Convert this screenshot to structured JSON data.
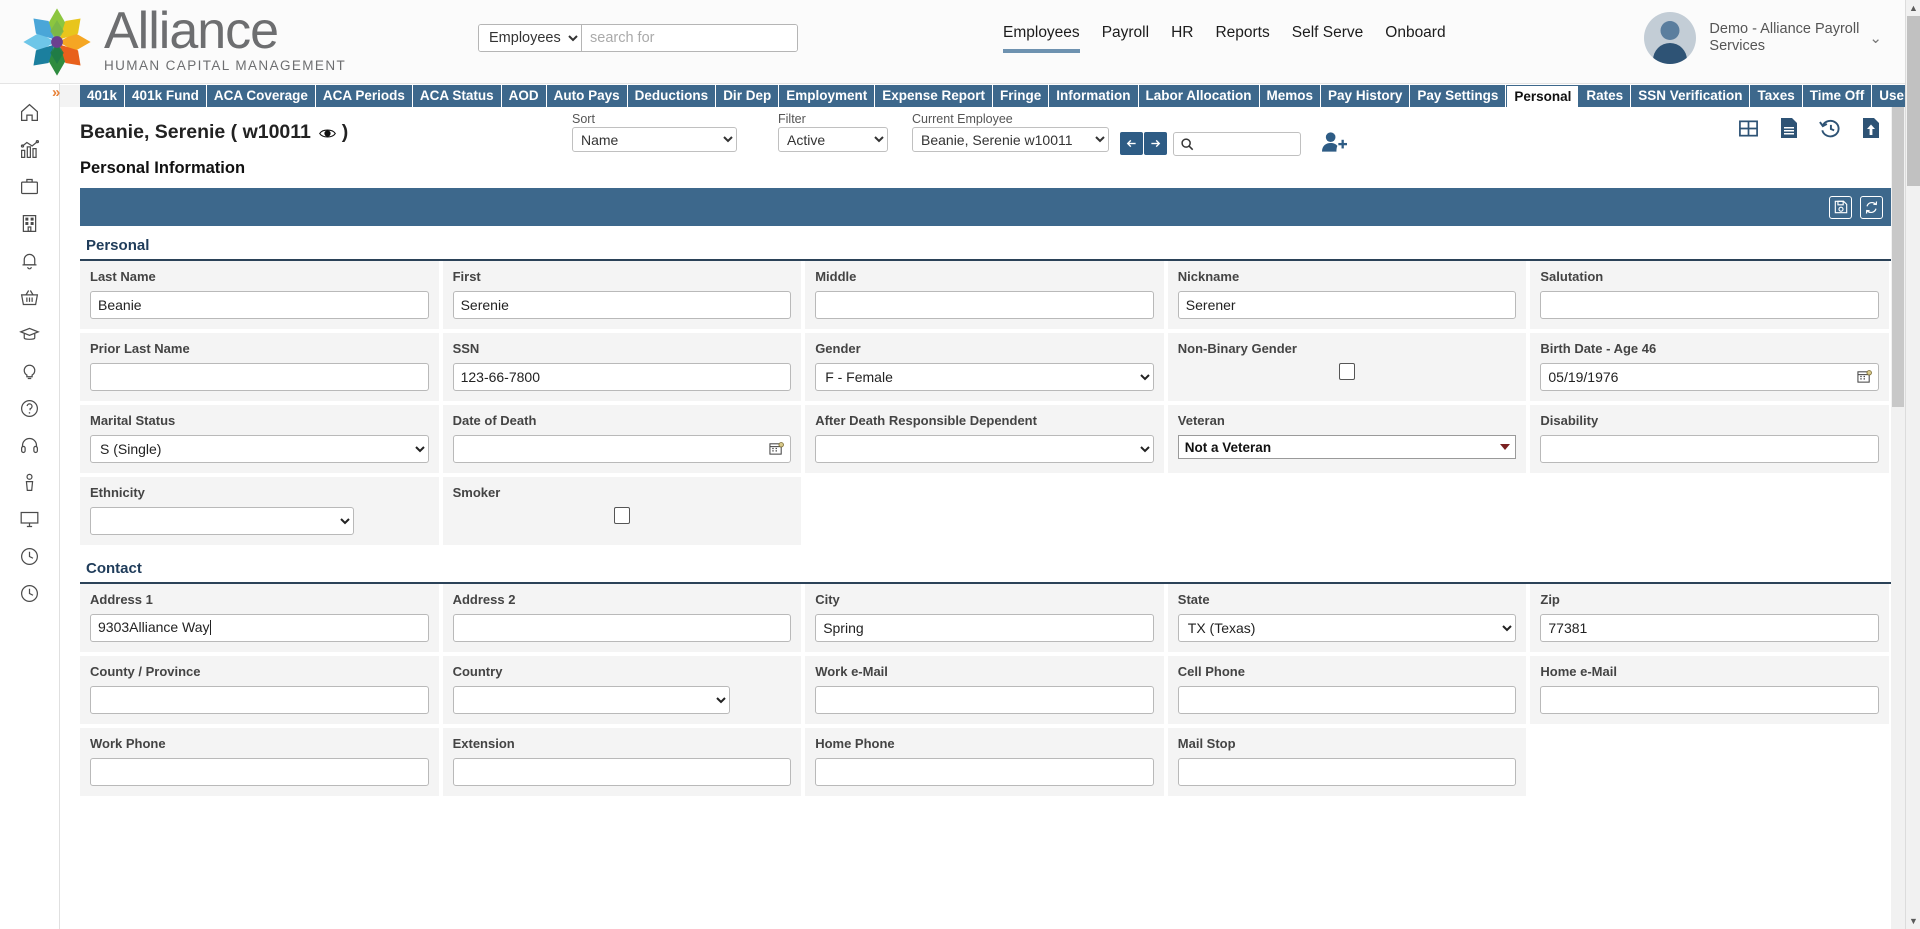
{
  "brand": {
    "name": "Alliance",
    "subtitle": "HUMAN CAPITAL MANAGEMENT"
  },
  "search": {
    "scope": "Employees",
    "placeholder": "search for",
    "value": ""
  },
  "mainnav": [
    {
      "label": "Employees",
      "active": true
    },
    {
      "label": "Payroll",
      "active": false
    },
    {
      "label": "HR",
      "active": false
    },
    {
      "label": "Reports",
      "active": false
    },
    {
      "label": "Self Serve",
      "active": false
    },
    {
      "label": "Onboard",
      "active": false
    }
  ],
  "profile": {
    "name": "Demo - Alliance Payroll Services",
    "caret": "⌄"
  },
  "sidebar": {
    "items": [
      {
        "icon": "home-icon"
      },
      {
        "icon": "analytics-icon"
      },
      {
        "icon": "briefcase-icon"
      },
      {
        "icon": "building-icon"
      },
      {
        "icon": "bell-icon"
      },
      {
        "icon": "basket-icon"
      },
      {
        "icon": "graduation-cap-icon"
      },
      {
        "icon": "lightbulb-icon"
      },
      {
        "icon": "question-circle-icon"
      },
      {
        "icon": "headphones-icon"
      },
      {
        "icon": "person-icon"
      },
      {
        "icon": "monitor-icon"
      },
      {
        "icon": "clock-icon"
      },
      {
        "icon": "clock-history-icon"
      }
    ]
  },
  "tabs": [
    {
      "label": "401k",
      "active": false
    },
    {
      "label": "401k Fund",
      "active": false
    },
    {
      "label": "ACA Coverage",
      "active": false
    },
    {
      "label": "ACA Periods",
      "active": false
    },
    {
      "label": "ACA Status",
      "active": false
    },
    {
      "label": "AOD",
      "active": false
    },
    {
      "label": "Auto Pays",
      "active": false
    },
    {
      "label": "Deductions",
      "active": false
    },
    {
      "label": "Dir Dep",
      "active": false
    },
    {
      "label": "Employment",
      "active": false
    },
    {
      "label": "Expense Report",
      "active": false
    },
    {
      "label": "Fringe",
      "active": false
    },
    {
      "label": "Information",
      "active": false
    },
    {
      "label": "Labor Allocation",
      "active": false
    },
    {
      "label": "Memos",
      "active": false
    },
    {
      "label": "Pay History",
      "active": false
    },
    {
      "label": "Pay Settings",
      "active": false
    },
    {
      "label": "Personal",
      "active": true
    },
    {
      "label": "Rates",
      "active": false
    },
    {
      "label": "SSN Verification",
      "active": false
    },
    {
      "label": "Taxes",
      "active": false
    },
    {
      "label": "Time Off",
      "active": false
    },
    {
      "label": "User Defined",
      "active": false
    }
  ],
  "employee_header": {
    "name": "Beanie, Serenie ( w10011",
    "name_suffix": ")",
    "sort_label": "Sort",
    "sort_value": "Name",
    "filter_label": "Filter",
    "filter_value": "Active",
    "current_label": "Current Employee",
    "current_value": "Beanie, Serenie w10011",
    "prev_icon": "arrow-left-icon",
    "next_icon": "arrow-right-icon",
    "search_icon": "search-icon",
    "add_employee_icon": "add-user-icon"
  },
  "toolbar": {
    "grid_icon": "grid-view-icon",
    "document_icon": "document-icon",
    "history_icon": "history-clock-icon",
    "upload_icon": "upload-document-icon"
  },
  "page_title": "Personal Information",
  "bluebar": {
    "save_icon": "save-disk-icon",
    "refresh_icon": "refresh-sync-icon"
  },
  "sections": [
    {
      "title": "Personal",
      "rows": [
        [
          {
            "label": "Last Name",
            "type": "text",
            "value": "Beanie"
          },
          {
            "label": "First",
            "type": "text",
            "value": "Serenie"
          },
          {
            "label": "Middle",
            "type": "text",
            "value": ""
          },
          {
            "label": "Nickname",
            "type": "text",
            "value": "Serener"
          },
          {
            "label": "Salutation",
            "type": "text",
            "value": ""
          }
        ],
        [
          {
            "label": "Prior Last Name",
            "type": "text",
            "value": ""
          },
          {
            "label": "SSN",
            "type": "text",
            "value": "123-66-7800"
          },
          {
            "label": "Gender",
            "type": "select",
            "value": "F - Female"
          },
          {
            "label": "Non-Binary Gender",
            "type": "checkbox",
            "value": false
          },
          {
            "label": "Birth Date - Age 46",
            "type": "date",
            "value": "05/19/1976"
          }
        ],
        [
          {
            "label": "Marital Status",
            "type": "select",
            "value": "S (Single)"
          },
          {
            "label": "Date of Death",
            "type": "date",
            "value": ""
          },
          {
            "label": "After Death Responsible Dependent",
            "type": "select",
            "value": ""
          },
          {
            "label": "Veteran",
            "type": "vetselect",
            "value": "Not a Veteran"
          },
          {
            "label": "Disability",
            "type": "text",
            "value": ""
          }
        ],
        [
          {
            "label": "Ethnicity",
            "type": "select",
            "value": ""
          },
          {
            "label": "Smoker",
            "type": "checkbox",
            "value": false
          },
          {
            "label": "",
            "type": "blank",
            "value": ""
          },
          {
            "label": "",
            "type": "blank",
            "value": ""
          },
          {
            "label": "",
            "type": "blank",
            "value": ""
          }
        ]
      ]
    },
    {
      "title": "Contact",
      "rows": [
        [
          {
            "label": "Address 1",
            "type": "focustext",
            "value": "9303Alliance Way"
          },
          {
            "label": "Address 2",
            "type": "text",
            "value": ""
          },
          {
            "label": "City",
            "type": "text",
            "value": "Spring"
          },
          {
            "label": "State",
            "type": "select",
            "value": "TX (Texas)"
          },
          {
            "label": "Zip",
            "type": "text",
            "value": "77381"
          }
        ],
        [
          {
            "label": "County / Province",
            "type": "text",
            "value": ""
          },
          {
            "label": "Country",
            "type": "select",
            "value": ""
          },
          {
            "label": "Work e-Mail",
            "type": "text",
            "value": ""
          },
          {
            "label": "Cell Phone",
            "type": "text",
            "value": ""
          },
          {
            "label": "Home e-Mail",
            "type": "text",
            "value": ""
          }
        ],
        [
          {
            "label": "Work Phone",
            "type": "text",
            "value": ""
          },
          {
            "label": "Extension",
            "type": "text",
            "value": ""
          },
          {
            "label": "Home Phone",
            "type": "text",
            "value": ""
          },
          {
            "label": "Mail Stop",
            "type": "text",
            "value": ""
          },
          {
            "label": "",
            "type": "blank",
            "value": ""
          }
        ]
      ]
    }
  ],
  "colors": {
    "tab_blue": "#3d688c",
    "accent_blue": "#2e5c85",
    "section_underline": "#2b4258",
    "nav_active": "#6e92b0",
    "orange": "#e8833a",
    "veteran_arrow": "#7a2020"
  }
}
